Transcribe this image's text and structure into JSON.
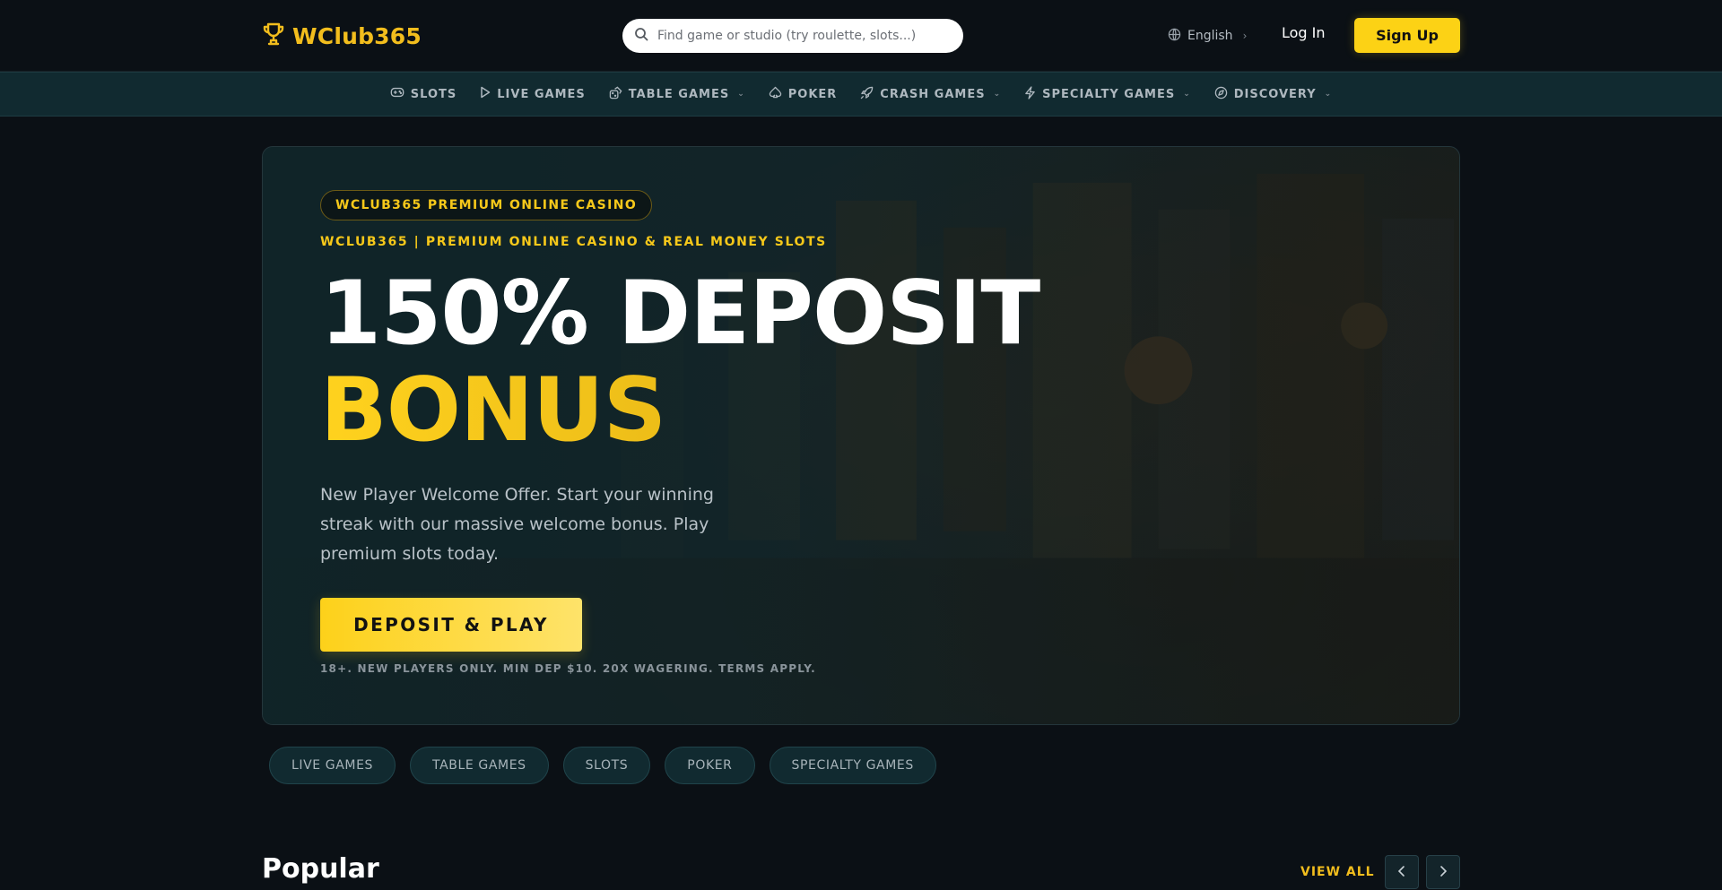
{
  "header": {
    "brand": "WClub365",
    "search_placeholder": "Find game or studio (try roulette, slots...)",
    "language": "English",
    "login_label": "Log In",
    "signup_label": "Sign Up"
  },
  "nav": {
    "items": [
      {
        "label": "SLOTS",
        "icon": "gamepad-icon",
        "dropdown": false
      },
      {
        "label": "LIVE GAMES",
        "icon": "play-icon",
        "dropdown": false
      },
      {
        "label": "TABLE GAMES",
        "icon": "dice-icon",
        "dropdown": true
      },
      {
        "label": "POKER",
        "icon": "spade-icon",
        "dropdown": false
      },
      {
        "label": "CRASH GAMES",
        "icon": "rocket-icon",
        "dropdown": true
      },
      {
        "label": "SPECIALTY GAMES",
        "icon": "lightning-icon",
        "dropdown": true
      },
      {
        "label": "DISCOVERY",
        "icon": "compass-icon",
        "dropdown": true
      }
    ]
  },
  "hero": {
    "pill": "WCLUB365 PREMIUM ONLINE CASINO",
    "kicker": "WCLUB365 | PREMIUM ONLINE CASINO & REAL MONEY SLOTS",
    "headline_line1": "150% DEPOSIT",
    "headline_line2": "BONUS",
    "description": "New Player Welcome Offer. Start your winning streak with our massive welcome bonus. Play premium slots today.",
    "cta_label": "DEPOSIT & PLAY",
    "terms": "18+. NEW PLAYERS ONLY. MIN DEP $10. 20X WAGERING. TERMS APPLY."
  },
  "categories": [
    "LIVE GAMES",
    "TABLE GAMES",
    "SLOTS",
    "POKER",
    "SPECIALTY GAMES"
  ],
  "popular": {
    "title": "Popular",
    "view_all": "VIEW ALL"
  },
  "colors": {
    "accent": "#fcd215",
    "background": "#0b1015",
    "nav_background": "#112a30"
  }
}
